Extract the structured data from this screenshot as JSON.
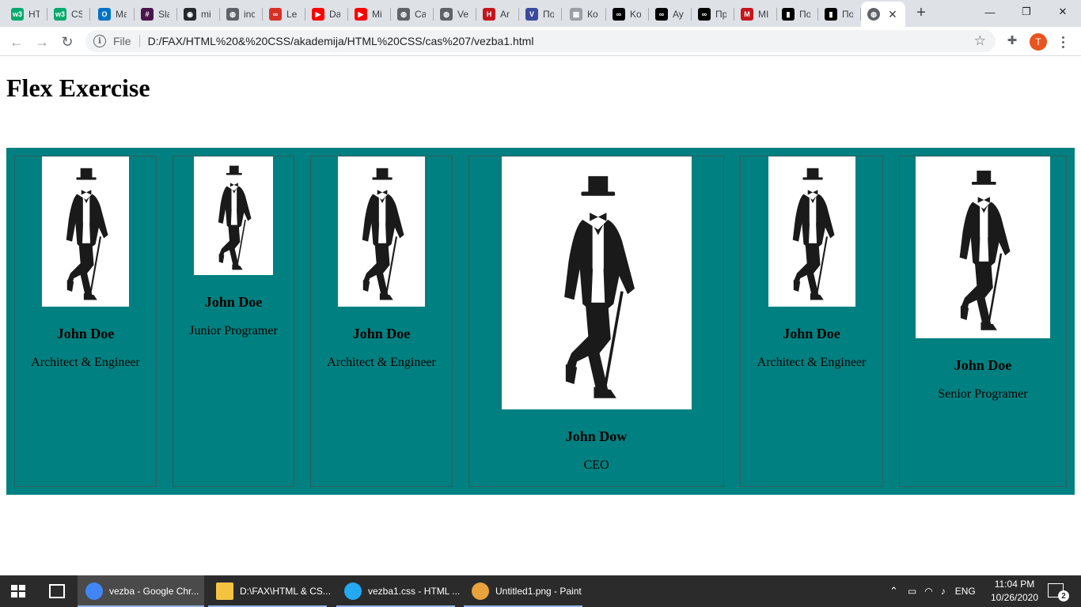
{
  "browser": {
    "tabs": [
      {
        "label": "HT",
        "icon": "w3schools-icon",
        "color": "#04aa6d",
        "glyph": "w3"
      },
      {
        "label": "CS",
        "icon": "w3schools-icon",
        "color": "#04aa6d",
        "glyph": "w3"
      },
      {
        "label": "Ma",
        "icon": "outlook-icon",
        "color": "#0072c6",
        "glyph": "O"
      },
      {
        "label": "Sla",
        "icon": "slack-icon",
        "color": "#4a154b",
        "glyph": "#"
      },
      {
        "label": "mi",
        "icon": "github-icon",
        "color": "#24292e",
        "glyph": "◉"
      },
      {
        "label": "inc",
        "icon": "globe-icon",
        "color": "#5f6368",
        "glyph": "◍"
      },
      {
        "label": "Le",
        "icon": "link-icon",
        "color": "#d93025",
        "glyph": "∞"
      },
      {
        "label": "Da",
        "icon": "youtube-icon",
        "color": "#ff0000",
        "glyph": "▶"
      },
      {
        "label": "Mi",
        "icon": "youtube-icon",
        "color": "#ff0000",
        "glyph": "▶"
      },
      {
        "label": "Ca",
        "icon": "globe-icon",
        "color": "#5f6368",
        "glyph": "◍"
      },
      {
        "label": "Ve",
        "icon": "globe-icon",
        "color": "#5f6368",
        "glyph": "◍"
      },
      {
        "label": "Ar",
        "icon": "h-logo-icon",
        "color": "#c4161c",
        "glyph": "H"
      },
      {
        "label": "По",
        "icon": "v-logo-icon",
        "color": "#3b4a9b",
        "glyph": "V"
      },
      {
        "label": "Ко",
        "icon": "image-icon",
        "color": "#9aa0a6",
        "glyph": "▦"
      },
      {
        "label": "Ko",
        "icon": "tripadvisor-icon",
        "color": "#000000",
        "glyph": "∞"
      },
      {
        "label": "Ay",
        "icon": "tripadvisor-icon",
        "color": "#000000",
        "glyph": "∞"
      },
      {
        "label": "Пр",
        "icon": "tripadvisor-icon",
        "color": "#000000",
        "glyph": "∞"
      },
      {
        "label": "МІ",
        "icon": "mkd-icon",
        "color": "#c4161c",
        "glyph": "M"
      },
      {
        "label": "По",
        "icon": "bookmark-icon",
        "color": "#000000",
        "glyph": "▮"
      },
      {
        "label": "По",
        "icon": "bookmark-icon",
        "color": "#000000",
        "glyph": "▮"
      }
    ],
    "active_tab_close": "✕",
    "new_tab": "+",
    "window": {
      "minimize": "—",
      "maximize": "❐",
      "close": "✕"
    },
    "nav": {
      "back": "←",
      "forward": "→",
      "reload": "↻"
    },
    "address": {
      "info": "i",
      "scheme_label": "File",
      "url": "D:/FAX/HTML%20&%20CSS/akademija/HTML%20CSS/cas%207/vezba1.html",
      "star": "☆"
    },
    "extensions_glyph": "✚",
    "profile_initial": "T"
  },
  "page": {
    "title": "Flex Exercise",
    "cards": [
      {
        "name": "John Doe",
        "role": "Architect & Engineer"
      },
      {
        "name": "John Doe",
        "role": "Junior Programer"
      },
      {
        "name": "John Doe",
        "role": "Architect & Engineer"
      },
      {
        "name": "John Dow",
        "role": "CEO"
      },
      {
        "name": "John Doe",
        "role": "Architect & Engineer"
      },
      {
        "name": "John Doe",
        "role": "Senior Programer"
      }
    ],
    "container_color": "#008080"
  },
  "taskbar": {
    "apps": [
      {
        "label": "vezba - Google Chr...",
        "icon": "chrome-icon",
        "color": "#4285f4",
        "active": true
      },
      {
        "label": "D:\\FAX\\HTML & CS...",
        "icon": "folder-icon",
        "color": "#f5c342",
        "active": false
      },
      {
        "label": "vezba1.css - HTML ...",
        "icon": "vscode-icon",
        "color": "#23a9f2",
        "active": false
      },
      {
        "label": "Untitled1.png - Paint",
        "icon": "paint-icon",
        "color": "#e8a33d",
        "active": false
      }
    ],
    "language": "ENG",
    "time": "11:04 PM",
    "date": "10/26/2020",
    "notifications": "2"
  }
}
